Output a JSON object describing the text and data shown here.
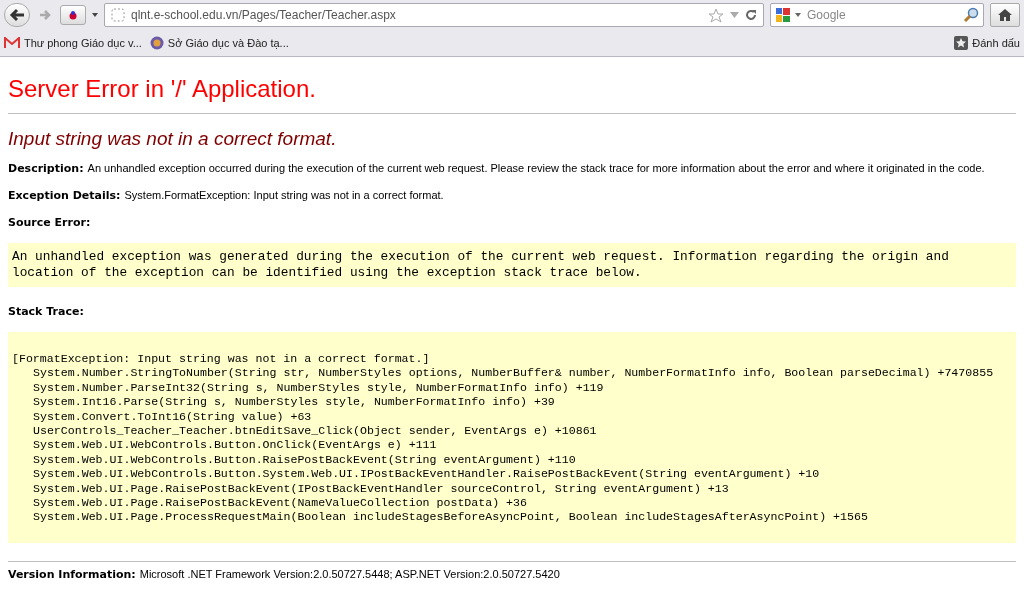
{
  "browser": {
    "url": "qlnt.e-school.edu.vn/Pages/Teacher/Teacher.aspx",
    "search": {
      "placeholder": "Google"
    },
    "bookmarks": [
      {
        "kind": "mail",
        "label": "Thư phong Giáo dục v..."
      },
      {
        "kind": "emblem",
        "label": "Sở Giáo dục và Đào tạ..."
      }
    ],
    "bookmarks_menu": "Đánh dấu"
  },
  "page": {
    "title": "Server Error in '/' Application.",
    "subtitle": "Input string was not in a correct format.",
    "description": {
      "label": "Description:",
      "text": "An unhandled exception occurred during the execution of the current web request. Please review the stack trace for more information about the error and where it originated in the code."
    },
    "exception_details": {
      "label": "Exception Details:",
      "text": "System.FormatException: Input string was not in a correct format."
    },
    "source_error": {
      "label": "Source Error:",
      "lines": [
        "An unhandled exception was generated during the execution of the current web request. Information regarding the origin and",
        "location of the exception can be identified using the exception stack trace below."
      ]
    },
    "stack_trace": {
      "label": "Stack Trace:",
      "lines": [
        {
          "kind": "exception",
          "text": "[FormatException: Input string was not in a correct format.]"
        },
        {
          "kind": "frame",
          "text": "System.Number.StringToNumber(String str, NumberStyles options, NumberBuffer& number, NumberFormatInfo info, Boolean parseDecimal) +7470855"
        },
        {
          "kind": "frame",
          "text": "System.Number.ParseInt32(String s, NumberStyles style, NumberFormatInfo info) +119"
        },
        {
          "kind": "frame",
          "text": "System.Int16.Parse(String s, NumberStyles style, NumberFormatInfo info) +39"
        },
        {
          "kind": "frame",
          "text": "System.Convert.ToInt16(String value) +63"
        },
        {
          "kind": "frame",
          "text": "UserControls_Teacher_Teacher.btnEditSave_Click(Object sender, EventArgs e) +10861"
        },
        {
          "kind": "frame",
          "text": "System.Web.UI.WebControls.Button.OnClick(EventArgs e) +111"
        },
        {
          "kind": "frame",
          "text": "System.Web.UI.WebControls.Button.RaisePostBackEvent(String eventArgument) +110"
        },
        {
          "kind": "frame",
          "text": "System.Web.UI.WebControls.Button.System.Web.UI.IPostBackEventHandler.RaisePostBackEvent(String eventArgument) +10"
        },
        {
          "kind": "frame",
          "text": "System.Web.UI.Page.RaisePostBackEvent(IPostBackEventHandler sourceControl, String eventArgument) +13"
        },
        {
          "kind": "frame",
          "text": "System.Web.UI.Page.RaisePostBackEvent(NameValueCollection postData) +36"
        },
        {
          "kind": "frame",
          "text": "System.Web.UI.Page.ProcessRequestMain(Boolean includeStagesBeforeAsyncPoint, Boolean includeStagesAfterAsyncPoint) +1565"
        }
      ]
    },
    "version": {
      "label": "Version Information:",
      "text": "Microsoft .NET Framework Version:2.0.50727.5448; ASP.NET Version:2.0.50727.5420"
    }
  }
}
